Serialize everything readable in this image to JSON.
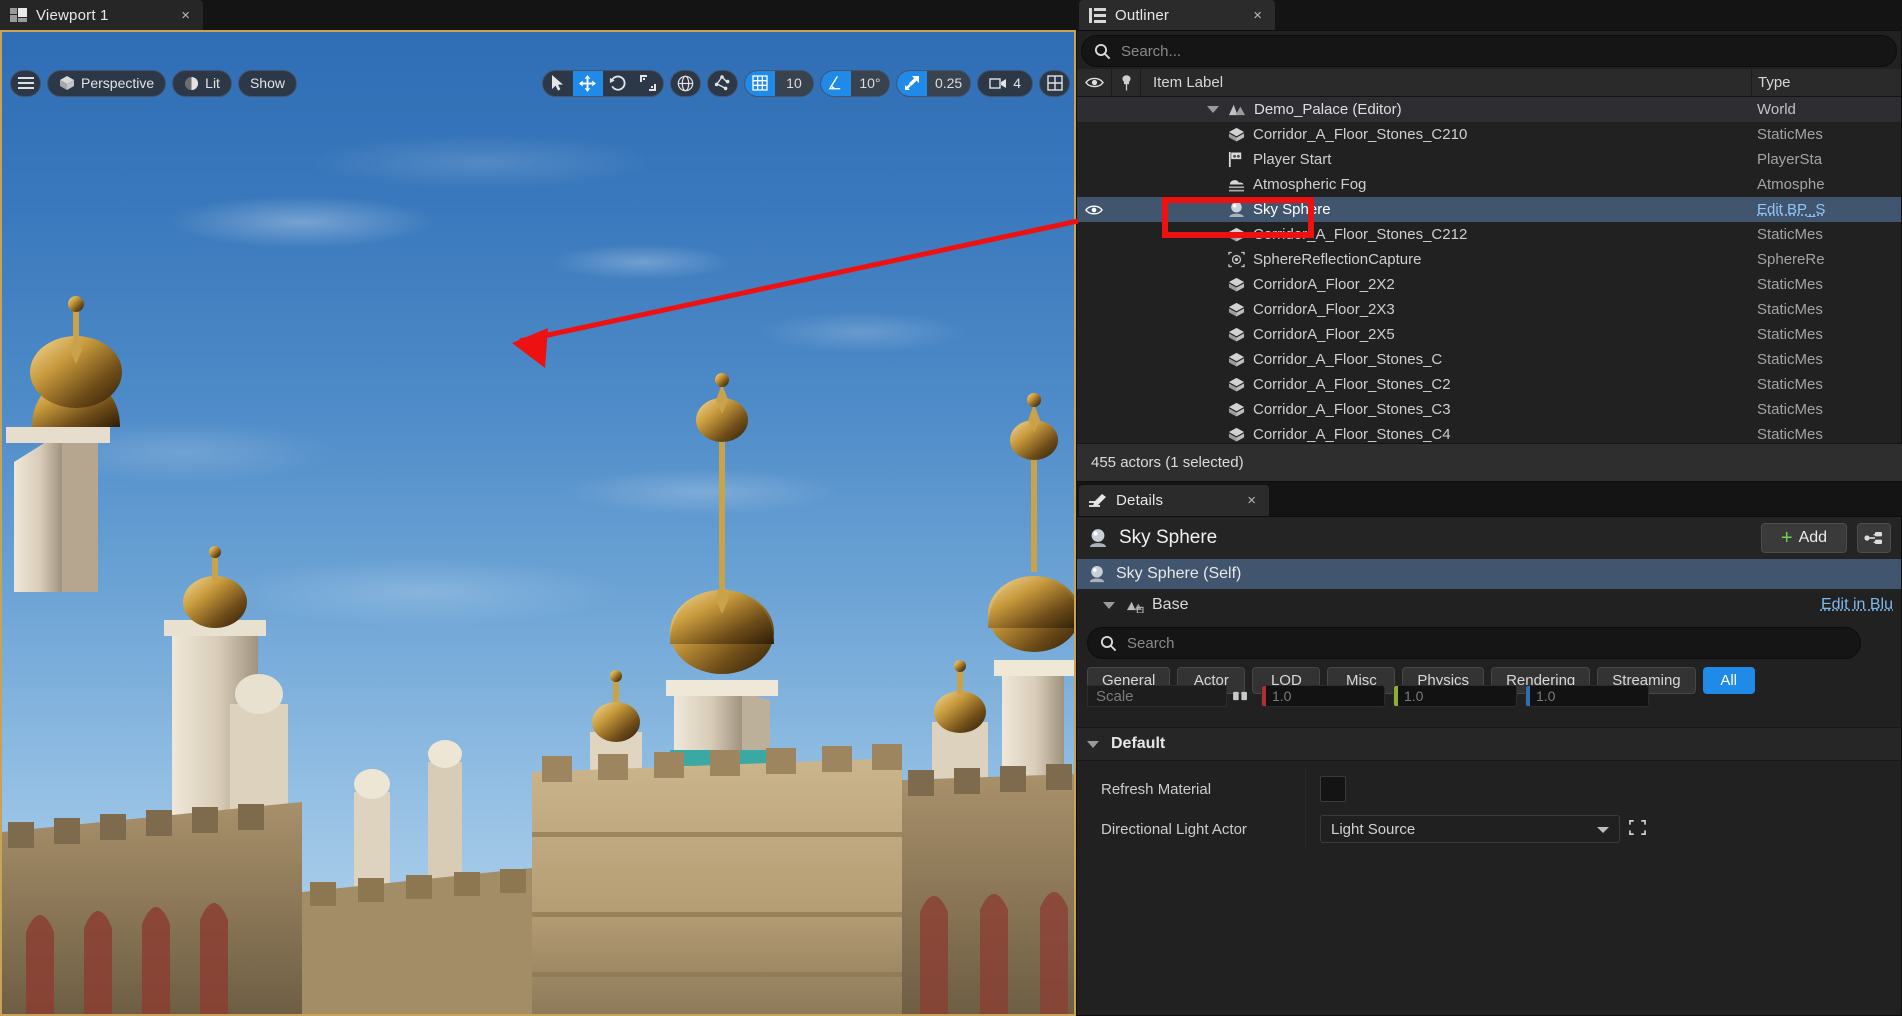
{
  "viewport": {
    "tab_label": "Viewport 1",
    "tab_close": "×",
    "toolbar": {
      "menu_icon": "hamburger-menu-icon",
      "camera_mode": "Perspective",
      "view_mode": "Lit",
      "show_menu": "Show",
      "select_tool": "cursor-select-icon",
      "move_tool": "move-gizmo-icon",
      "rotate_tool": "rotate-gizmo-icon",
      "scale_tool": "scale-gizmo-icon",
      "coord_space": "globe-world-space-icon",
      "surface_snap": "surface-snap-icon",
      "grid_snap_icon": "grid-snap-icon",
      "grid_snap_value": "10",
      "angle_snap_icon": "angle-snap-icon",
      "angle_snap_value": "10°",
      "scale_snap_icon": "scale-snap-icon",
      "scale_snap_value": "0.25",
      "camera_speed_icon": "camera-icon",
      "camera_speed_value": "4",
      "layout_icon": "viewport-layout-icon"
    }
  },
  "outliner": {
    "tab_label": "Outliner",
    "tab_close": "×",
    "search_placeholder": "Search...",
    "columns": {
      "eye": "visibility-column",
      "pin": "pin-column",
      "label": "Item Label",
      "type": "Type"
    },
    "rows": [
      {
        "label": "Demo_Palace (Editor)",
        "type": "World",
        "icon": "world-icon",
        "indent": 1,
        "expander": true,
        "state": "world"
      },
      {
        "label": "Corridor_A_Floor_Stones_C210",
        "type": "StaticMes",
        "icon": "static-mesh-icon",
        "indent": 2,
        "expander": false,
        "state": ""
      },
      {
        "label": "Player Start",
        "type": "PlayerSta",
        "icon": "player-start-icon",
        "indent": 2,
        "expander": false,
        "state": ""
      },
      {
        "label": "Atmospheric Fog",
        "type": "Atmosphe",
        "icon": "atmospheric-fog-icon",
        "indent": 2,
        "expander": false,
        "state": ""
      },
      {
        "label": "Sky Sphere",
        "type": "Edit BP_S",
        "icon": "sky-sphere-icon",
        "indent": 2,
        "expander": false,
        "state": "selected"
      },
      {
        "label": "Corridor_A_Floor_Stones_C212",
        "type": "StaticMes",
        "icon": "static-mesh-icon",
        "indent": 2,
        "expander": false,
        "state": ""
      },
      {
        "label": "SphereReflectionCapture",
        "type": "SphereRe",
        "icon": "sphere-reflection-capture-icon",
        "indent": 2,
        "expander": false,
        "state": ""
      },
      {
        "label": "CorridorA_Floor_2X2",
        "type": "StaticMes",
        "icon": "static-mesh-icon",
        "indent": 2,
        "expander": false,
        "state": ""
      },
      {
        "label": "CorridorA_Floor_2X3",
        "type": "StaticMes",
        "icon": "static-mesh-icon",
        "indent": 2,
        "expander": false,
        "state": ""
      },
      {
        "label": "CorridorA_Floor_2X5",
        "type": "StaticMes",
        "icon": "static-mesh-icon",
        "indent": 2,
        "expander": false,
        "state": ""
      },
      {
        "label": "Corridor_A_Floor_Stones_C",
        "type": "StaticMes",
        "icon": "static-mesh-icon",
        "indent": 2,
        "expander": false,
        "state": ""
      },
      {
        "label": "Corridor_A_Floor_Stones_C2",
        "type": "StaticMes",
        "icon": "static-mesh-icon",
        "indent": 2,
        "expander": false,
        "state": ""
      },
      {
        "label": "Corridor_A_Floor_Stones_C3",
        "type": "StaticMes",
        "icon": "static-mesh-icon",
        "indent": 2,
        "expander": false,
        "state": ""
      },
      {
        "label": "Corridor_A_Floor_Stones_C4",
        "type": "StaticMes",
        "icon": "static-mesh-icon",
        "indent": 2,
        "expander": false,
        "state": ""
      }
    ],
    "status": "455 actors (1 selected)"
  },
  "details": {
    "tab_label": "Details",
    "tab_close": "×",
    "actor_name": "Sky Sphere",
    "add_button": "Add",
    "component_self": "Sky Sphere (Self)",
    "component_base": "Base",
    "edit_in_blueprint": "Edit in Blu",
    "search_placeholder": "Search",
    "filter_tabs": [
      {
        "label": "General",
        "active": false
      },
      {
        "label": "Actor",
        "active": false
      },
      {
        "label": "LOD",
        "active": false
      },
      {
        "label": "Misc",
        "active": false
      },
      {
        "label": "Physics",
        "active": false
      },
      {
        "label": "Rendering",
        "active": false
      },
      {
        "label": "Streaming",
        "active": false
      },
      {
        "label": "All",
        "active": true
      }
    ],
    "transform": {
      "scale_label": "Scale",
      "x": "1.0",
      "y": "1.0",
      "z": "1.0"
    },
    "section_default": "Default",
    "properties": [
      {
        "name": "Refresh Material",
        "kind": "checkbox",
        "value": ""
      },
      {
        "name": "Directional Light Actor",
        "kind": "combo",
        "value": "Light Source"
      }
    ]
  },
  "annotation": {
    "arrow_color": "#ee1111",
    "highlight_color": "#ee1111",
    "target": "Sky Sphere"
  }
}
